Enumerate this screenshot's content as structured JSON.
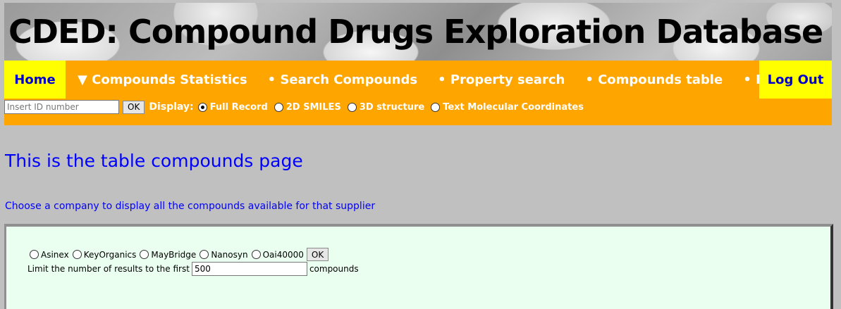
{
  "header": {
    "title": "CDED: Compound Drugs Exploration Database"
  },
  "nav": {
    "home": "Home",
    "items": [
      "▼ Compounds Statistics",
      "• Search Compounds",
      "• Property search",
      "• Compounds table",
      "• Help"
    ],
    "logout": "Log Out"
  },
  "search": {
    "id_placeholder": "Insert ID number",
    "ok_label": "OK",
    "display_label": "Display:",
    "display_options": [
      "Full Record",
      "2D SMILES",
      "3D structure",
      "Text Molecular Coordinates"
    ],
    "selected_display": "Full Record"
  },
  "main": {
    "heading": "This is the table compounds page",
    "subheading": "Choose a company to display all the compounds available for that supplier"
  },
  "form": {
    "companies": [
      "Asinex",
      "KeyOrganics",
      "MayBridge",
      "Nanosyn",
      "Oai40000"
    ],
    "ok_label": "OK",
    "limit_prefix": "Limit the number of results to the first",
    "limit_value": "500",
    "limit_suffix": "compounds"
  },
  "colors": {
    "background": "#c0c0c0",
    "nav": "#ffa500",
    "nav_highlight": "#ffff00",
    "link": "#0000ff",
    "panel": "#eafff0"
  }
}
